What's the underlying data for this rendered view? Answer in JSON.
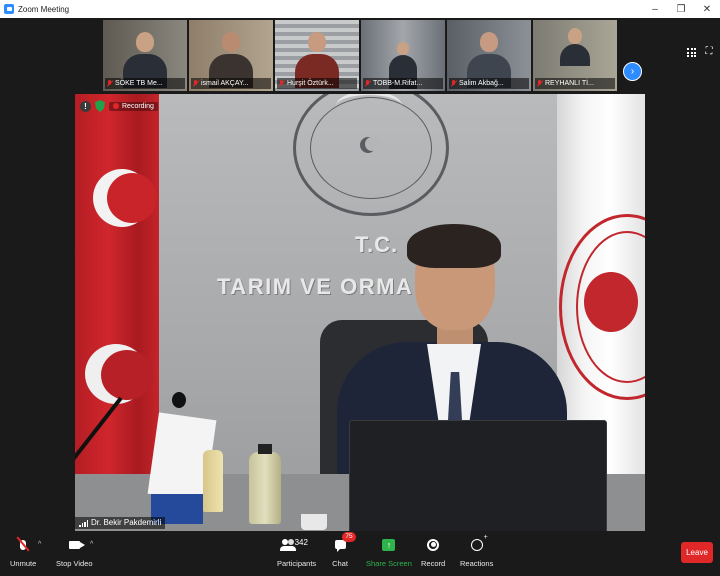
{
  "window": {
    "title": "Zoom Meeting",
    "controls": [
      "–",
      "❐",
      "✕"
    ]
  },
  "gallery": {
    "participants": [
      {
        "name": "SÖKE TB Me...",
        "muted": true,
        "bg": "#7a7770"
      },
      {
        "name": "ismail AKÇAY...",
        "muted": true,
        "bg": "#8b7b6b"
      },
      {
        "name": "Hurşit Öztürk...",
        "muted": true,
        "bg": "#9b9fa3"
      },
      {
        "name": "TOBB-M.Rifat...",
        "muted": true,
        "bg": "#7e8187"
      },
      {
        "name": "Salim Akbağ...",
        "muted": true,
        "bg": "#7b8088"
      },
      {
        "name": "REYHANLI Tİ...",
        "muted": true,
        "bg": "#7d7b72"
      }
    ],
    "next_icon": "chevron-right-icon"
  },
  "main": {
    "recording_label": "Recording",
    "speaker_name": "Dr. Bekir Pakdemirli",
    "wall_text_line1": "T.C.",
    "wall_text_line2": "TARIM VE ORMA    NLIĞI"
  },
  "toolbar": {
    "unmute_label": "Unmute",
    "stop_video_label": "Stop Video",
    "participants_label": "Participants",
    "participants_count": "342",
    "chat_label": "Chat",
    "chat_badge": "75",
    "share_screen_label": "Share Screen",
    "record_label": "Record",
    "reactions_label": "Reactions",
    "leave_label": "Leave"
  },
  "colors": {
    "accent": "#2d8cff",
    "leave": "#e02828",
    "share": "#2fb34b",
    "toolbar_bg": "#1a1a1a"
  }
}
